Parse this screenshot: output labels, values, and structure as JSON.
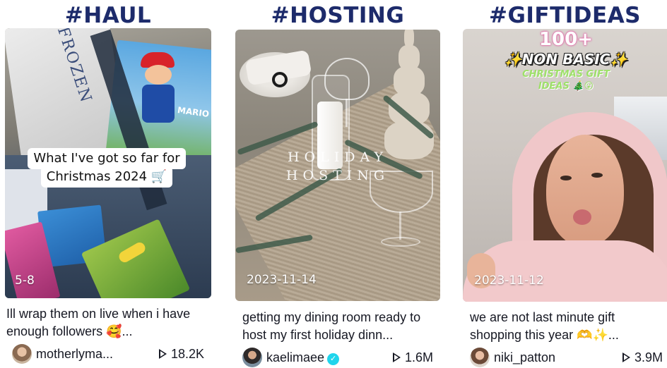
{
  "columns": [
    {
      "hashtag": "#HAUL",
      "thumbnail": {
        "overlay_caption_line1": "What I've got so far for",
        "overlay_caption_line2": "Christmas 2024 🛒",
        "frozen_box_text": "FROZEN",
        "mario_box_text": "MARIO",
        "date": "5-8"
      },
      "description": "Ill wrap them on live when i have enough followers 🥰...",
      "username": "motherlyma...",
      "verified": false,
      "views": "18.2K",
      "avatar_icon": "avatar-icon"
    },
    {
      "hashtag": "#HOSTING",
      "thumbnail": {
        "overlay_line1": "HOLIDAY",
        "overlay_line2": "HOSTING",
        "date": "2023-11-14"
      },
      "description": "getting my dining room ready to host my first holiday dinn...",
      "username": "kaelimaee",
      "verified": true,
      "views": "1.6M",
      "avatar_icon": "avatar-icon"
    },
    {
      "hashtag": "#GIFTIDEAS",
      "thumbnail": {
        "overlay_count": "100+",
        "overlay_headline": "✨NON BASIC✨",
        "overlay_sub_line1": "CHRISTMAS GIFT",
        "overlay_sub_line2": "IDEAS 🎄😮",
        "date": "2023-11-12"
      },
      "description": "we are not last minute gift shopping this year 🫶✨...",
      "username": "niki_patton",
      "verified": false,
      "views": "3.9M",
      "avatar_icon": "avatar-icon"
    }
  ],
  "icons": {
    "play": "play-icon",
    "verified": "verified-badge-icon"
  },
  "colors": {
    "hashtag": "#1d2b6b",
    "verified_badge": "#20d5ec",
    "text": "#161823"
  }
}
